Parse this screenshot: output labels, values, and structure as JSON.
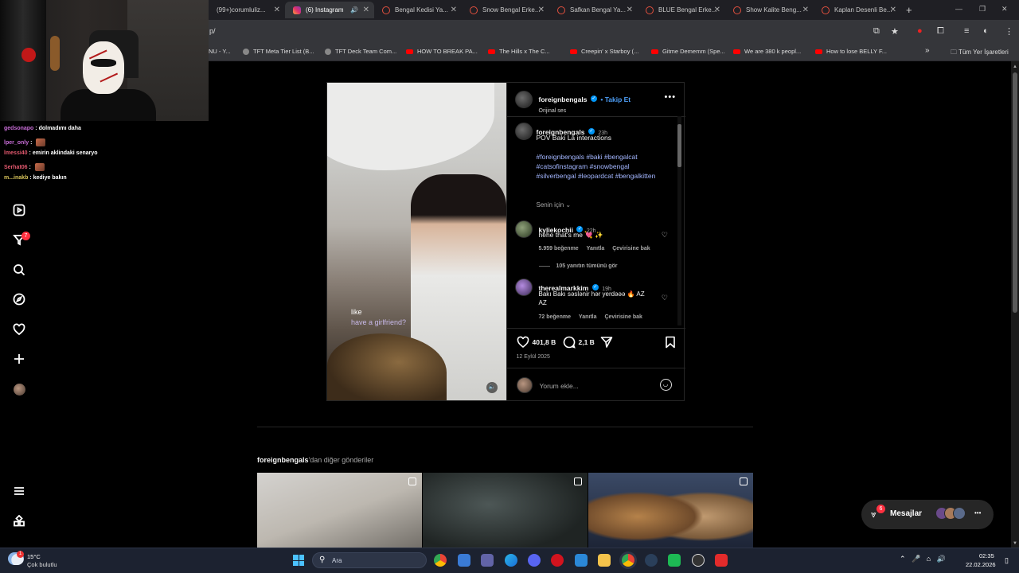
{
  "browser": {
    "tabs": [
      {
        "label": "(99+)corumluliz..."
      },
      {
        "label": "(6) Instagram"
      },
      {
        "label": "Bengal Kedisi Ya..."
      },
      {
        "label": "Snow Bengal Erke..."
      },
      {
        "label": "Safkan Bengal Ya..."
      },
      {
        "label": "BLUE Bengal Erke..."
      },
      {
        "label": "Show Kalite Beng..."
      },
      {
        "label": "Kaplan Desenli Be..."
      }
    ],
    "url": "p/",
    "bookmarks": [
      {
        "label": "NU - Y..."
      },
      {
        "label": "TFT Meta Tier List (B..."
      },
      {
        "label": "TFT Deck Team Com..."
      },
      {
        "label": "HOW TO BREAK PA..."
      },
      {
        "label": "The Hills x The C..."
      },
      {
        "label": "Creepin' x Starboy (..."
      },
      {
        "label": "Gitme Dememm (Spe..."
      },
      {
        "label": "We are 380 k peopl..."
      },
      {
        "label": "How to lose BELLY F..."
      }
    ],
    "bookmarks_folder": "Tüm Yer İşaretleri"
  },
  "nav": {
    "notif_count": "7"
  },
  "post": {
    "author": "foreignbengals",
    "follow_label": "Takip Et",
    "audio": "Orijinal ses",
    "caption_time": "23h",
    "caption": "POV Baki La interactions",
    "hashtags": "#foreignbengals #baki #bengalcat #catsofinstagram #snowbengal #silverbengal #leopardcat #bengalkitten",
    "for_you": "Senin için",
    "video_caption_1": "like",
    "video_caption_2": "have a girlfriend?",
    "comments": [
      {
        "user": "kyliekochii",
        "time": "22h",
        "text": "hehe that's me 💘 ✨",
        "likes": "5.959 beğenme",
        "reply": "Yanıtla",
        "translate": "Çevirisine bak",
        "view_replies": "105 yanıtın tümünü gör"
      },
      {
        "user": "therealmarkkim",
        "time": "19h",
        "text": "Bakı Bakı səslənir hər yerdəəə 🔥 AZ AZ",
        "likes": "72 beğenme",
        "reply": "Yanıtla",
        "translate": "Çevirisine bak"
      }
    ],
    "like_count": "401,8 B",
    "comment_count": "2,1 B",
    "date": "12 Eylül 2025",
    "comment_placeholder": "Yorum ekle..."
  },
  "more_posts": {
    "user": "foreignbengals",
    "suffix": "'dan diğer gönderiler"
  },
  "messages": {
    "label": "Mesajlar",
    "badge": "6"
  },
  "chat": [
    {
      "user": "gedsonapo",
      "text": "dolmadımı daha",
      "emote": false
    },
    {
      "user": "lper_only",
      "text": "",
      "emote": true
    },
    {
      "user": "lmessi40",
      "text": "emirin aklindaki senaryo",
      "emote": false
    },
    {
      "user": "Serhat06",
      "text": "",
      "emote": true
    },
    {
      "user": "m...inakb",
      "text": "kediye bakın",
      "emote": false
    }
  ],
  "taskbar": {
    "temp": "15°C",
    "weather": "Çok bulutlu",
    "weather_badge": "1",
    "search": "Ara",
    "time": "02:35",
    "date": "22.02.2026"
  },
  "colors": {
    "accent_blue": "#0095f6",
    "notification_red": "#ff3040",
    "hashtag_blue": "#a3b6ff"
  }
}
